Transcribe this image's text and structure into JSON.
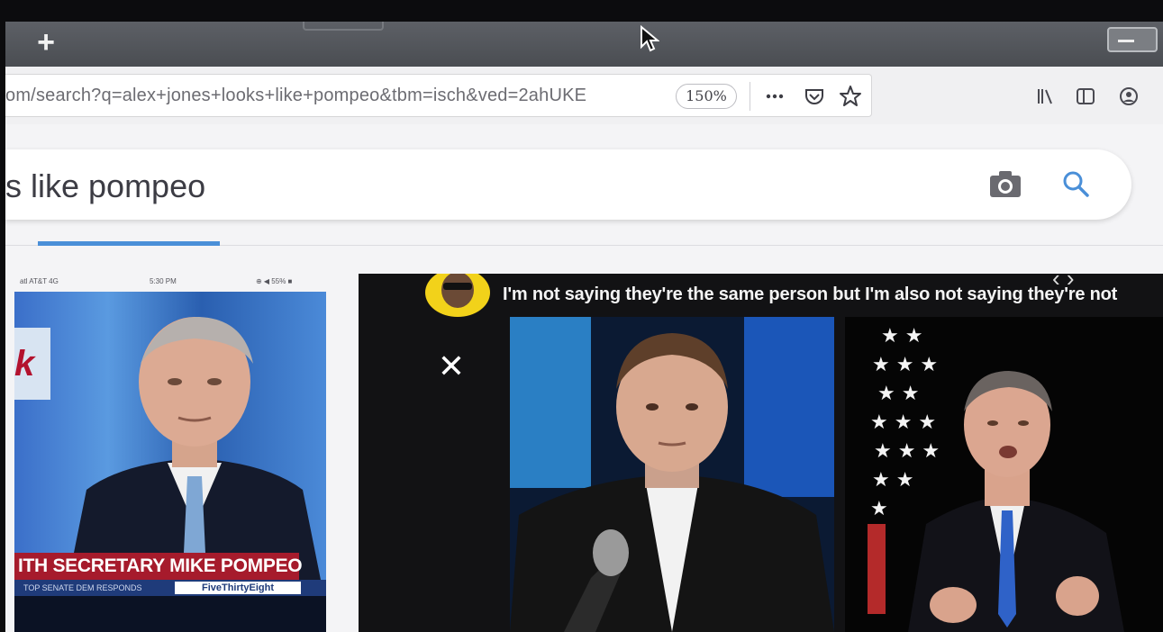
{
  "browser": {
    "url": "om/search?q=alex+jones+looks+like+pompeo&tbm=isch&ved=2ahUKE",
    "zoom": "150%",
    "url_actions": [
      "more-icon",
      "pocket-icon",
      "bookmark-star-icon"
    ],
    "toolbar": [
      "library-icon",
      "sidebar-icon",
      "account-icon"
    ]
  },
  "search": {
    "query": "s like pompeo"
  },
  "thumb": {
    "status_carrier": "atl AT&T 4G",
    "status_time": "5:30 PM",
    "status_battery": "⊕ ◀ 55% ■",
    "chyron": "ITH SECRETARY MIKE POMPEO",
    "chyron_sub": "TOP SENATE DEM RESPONDS",
    "chyron_brand": "FiveThirtyEight"
  },
  "preview": {
    "caption": "I'm not saying they're the same person but I'm also not saying they're not",
    "close": "✕",
    "nav": "‹ ›"
  }
}
